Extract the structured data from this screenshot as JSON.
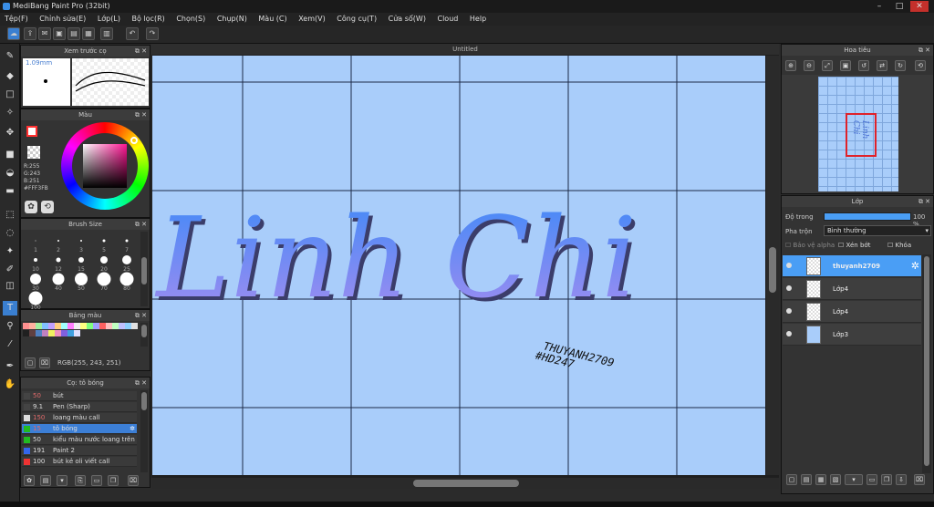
{
  "window": {
    "title": "MediBang Paint Pro (32bit)",
    "minimize": "–",
    "maximize": "□",
    "close": "✕"
  },
  "menu": [
    "Tệp(F)",
    "Chỉnh sửa(E)",
    "Lớp(L)",
    "Bộ lọc(R)",
    "Chọn(S)",
    "Chụp(N)",
    "Màu (C)",
    "Xem(V)",
    "Công cụ(T)",
    "Cửa sổ(W)",
    "Cloud",
    "Help"
  ],
  "panels": {
    "brush_preview": {
      "title": "Xem trước cọ",
      "size": "1.09mm"
    },
    "color": {
      "title": "Màu",
      "r": "R:255",
      "g": "G:243",
      "b": "B:251",
      "hex": "#FFF3FB",
      "primary": "#ff3030",
      "secondary": "#3060ff"
    },
    "brush_size": {
      "title": "Brush Size",
      "sizes": [
        "1",
        "2",
        "3",
        "5",
        "7",
        "10",
        "12",
        "15",
        "20",
        "25",
        "30",
        "40",
        "50",
        "70",
        "80",
        "100"
      ]
    },
    "palette": {
      "title": "Bảng màu",
      "rgb_readout": "RGB(255, 243, 251)"
    },
    "brush_list": {
      "title": "Cọ: tô bóng",
      "items": [
        {
          "size": "50",
          "name": "bút",
          "swatch": "#444444",
          "size_color": "#e06a6a"
        },
        {
          "size": "9.1",
          "name": "Pen (Sharp)",
          "swatch": "#444444",
          "size_color": "#dddddd"
        },
        {
          "size": "150",
          "name": "loang màu call",
          "swatch": "#dddddd",
          "size_color": "#e06a6a"
        },
        {
          "size": "15",
          "name": "tô bóng",
          "swatch": "#22bb22",
          "size_color": "#e06a6a",
          "selected": true
        },
        {
          "size": "50",
          "name": "kiểu màu nước loang trên",
          "swatch": "#22bb22",
          "size_color": "#dddddd"
        },
        {
          "size": "191",
          "name": "Paint 2",
          "swatch": "#3366ee",
          "size_color": "#dddddd"
        },
        {
          "size": "100",
          "name": "bút kẻ oli viết call",
          "swatch": "#ee3333",
          "size_color": "#dddddd"
        }
      ]
    },
    "navigator": {
      "title": "Hoa tiêu"
    },
    "layers": {
      "title": "Lớp",
      "opacity_label": "Độ trong",
      "opacity_value": "100 %",
      "blend_label": "Pha trộn",
      "blend_value": "Bình thường",
      "protect_alpha": "Bảo vệ alpha",
      "clipping": "Xén bớt",
      "lock": "Khóa",
      "items": [
        {
          "name": "thuyanh2709",
          "selected": true
        },
        {
          "name": "Lớp4",
          "selected": false
        },
        {
          "name": "Lớp4",
          "selected": false
        },
        {
          "name": "Lớp3",
          "selected": false
        }
      ]
    }
  },
  "canvas": {
    "tab_title": "Untitled",
    "main_text": "Linh Chi",
    "signature_line1": "THUYANH2709",
    "signature_line2": "#HD247",
    "bg_color": "#a9cdfa",
    "grid_color": "#1d2a48"
  }
}
